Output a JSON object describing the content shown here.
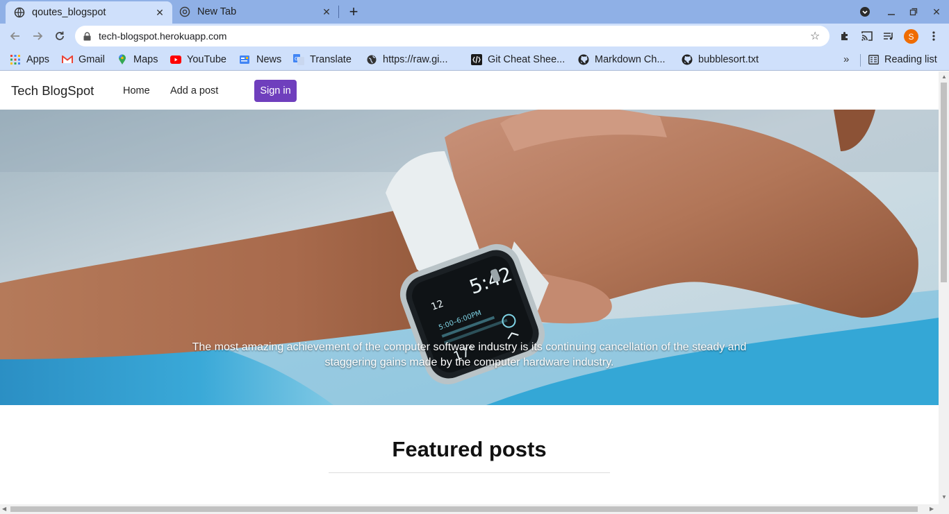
{
  "browser": {
    "tabs": [
      {
        "title": "qoutes_blogspot",
        "icon": "globe-icon",
        "active": true
      },
      {
        "title": "New Tab",
        "icon": "chrome-icon",
        "active": false
      }
    ],
    "url": "tech-blogspot.herokuapp.com",
    "profile_initial": "S",
    "bookmarks": [
      {
        "label": "Apps",
        "icon": "apps-grid-icon"
      },
      {
        "label": "Gmail",
        "icon": "gmail-icon"
      },
      {
        "label": "Maps",
        "icon": "maps-icon"
      },
      {
        "label": "YouTube",
        "icon": "youtube-icon"
      },
      {
        "label": "News",
        "icon": "news-icon"
      },
      {
        "label": "Translate",
        "icon": "translate-icon"
      },
      {
        "label": "https://raw.gi...",
        "icon": "globe-icon"
      },
      {
        "label": "Git Cheat Shee...",
        "icon": "devhints-icon"
      },
      {
        "label": "Markdown Ch...",
        "icon": "github-icon"
      },
      {
        "label": "bubblesort.txt",
        "icon": "github-icon"
      }
    ],
    "bookmarks_overflow": "»",
    "reading_list": "Reading list",
    "colors": {
      "tabstrip": "#8fb0e6",
      "toolbar": "#cfe0fb",
      "profile": "#ef6c00"
    }
  },
  "site": {
    "brand": "Tech BlogSpot",
    "nav": {
      "home": "Home",
      "add_post": "Add a post"
    },
    "signin": "Sign in",
    "hero_quote": "The most amazing achievement of the computer software industry is its continuing cancellation of the steady and staggering gains made by the computer hardware industry.",
    "featured_heading": "Featured posts",
    "colors": {
      "signin_bg": "#6f3fbd"
    }
  }
}
